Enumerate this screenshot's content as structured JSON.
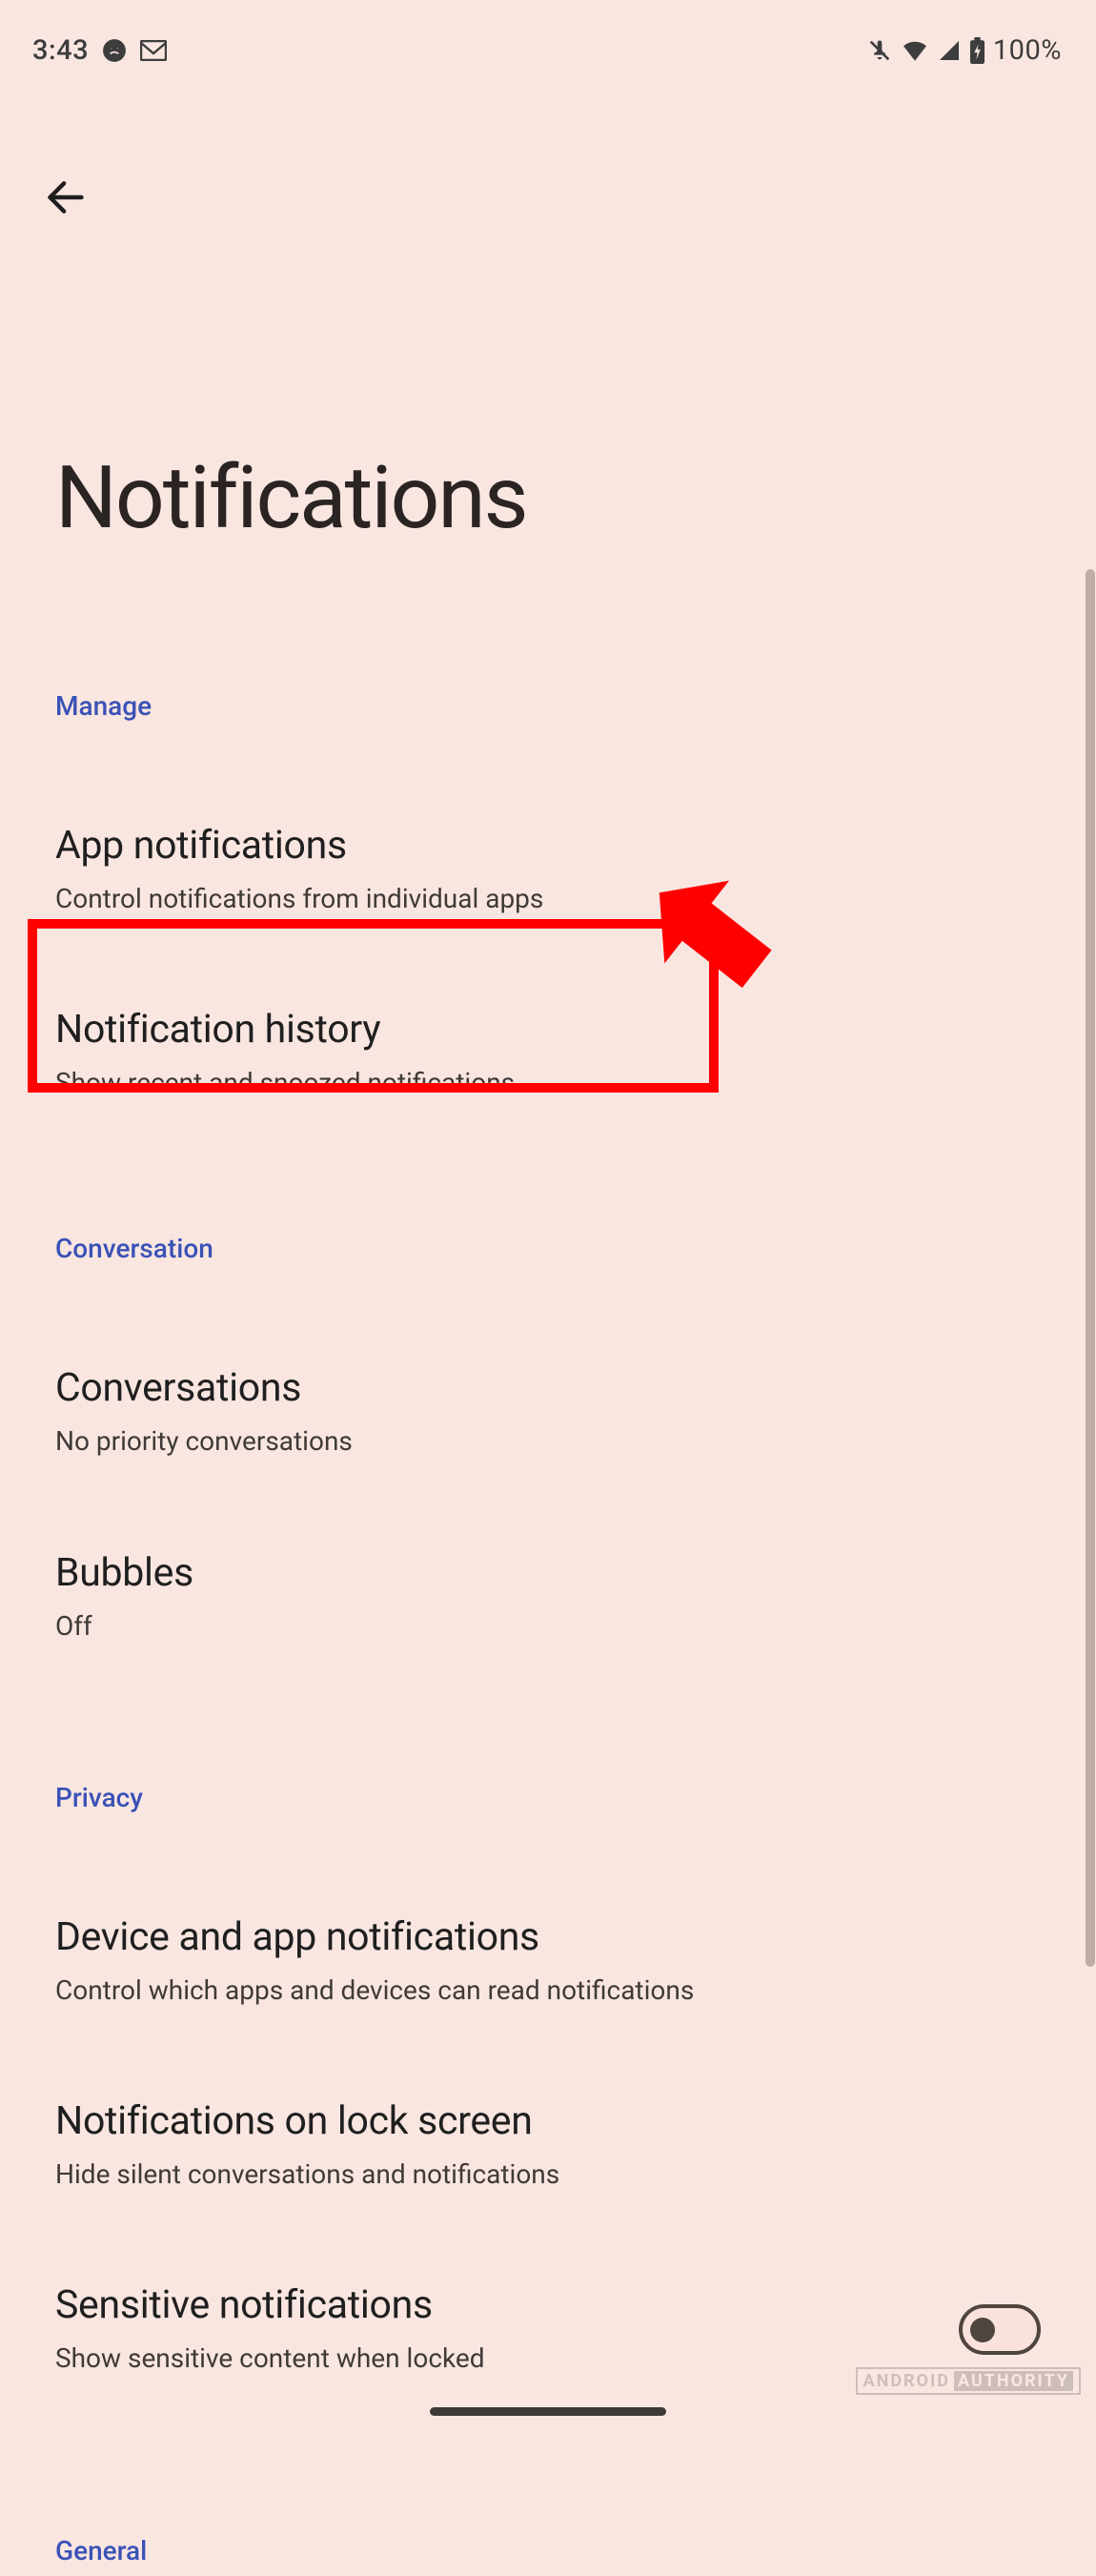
{
  "status": {
    "time": "3:43",
    "battery": "100%"
  },
  "page": {
    "title": "Notifications"
  },
  "sections": {
    "manage": {
      "header": "Manage",
      "app_notifications": {
        "title": "App notifications",
        "sub": "Control notifications from individual apps"
      },
      "notification_history": {
        "title": "Notification history",
        "sub": "Show recent and snoozed notifications"
      }
    },
    "conversation": {
      "header": "Conversation",
      "conversations": {
        "title": "Conversations",
        "sub": "No priority conversations"
      },
      "bubbles": {
        "title": "Bubbles",
        "sub": "Off"
      }
    },
    "privacy": {
      "header": "Privacy",
      "device_app": {
        "title": "Device and app notifications",
        "sub": "Control which apps and devices can read notifications"
      },
      "lock_screen": {
        "title": "Notifications on lock screen",
        "sub": "Hide silent conversations and notifications"
      },
      "sensitive": {
        "title": "Sensitive notifications",
        "sub": "Show sensitive content when locked"
      }
    },
    "general": {
      "header": "General"
    }
  },
  "watermark": {
    "a": "ANDROID",
    "b": "AUTHORITY"
  }
}
